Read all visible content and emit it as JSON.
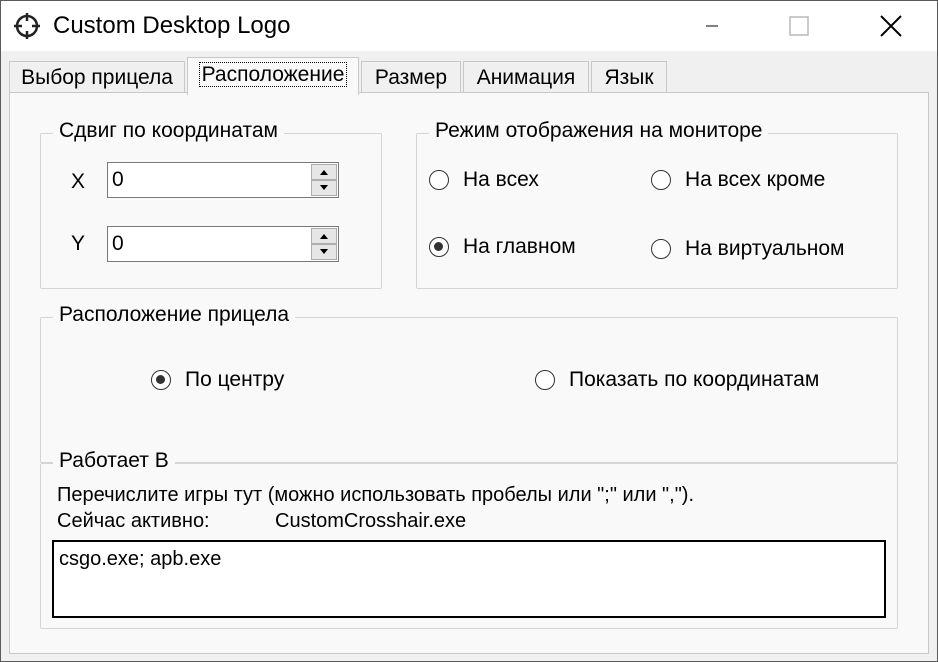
{
  "window": {
    "title": "Custom Desktop Logo"
  },
  "tabs": [
    {
      "label": "Выбор прицела",
      "active": false
    },
    {
      "label": "Расположение",
      "active": true
    },
    {
      "label": "Размер",
      "active": false
    },
    {
      "label": "Анимация",
      "active": false
    },
    {
      "label": "Язык",
      "active": false
    }
  ],
  "offset_group": {
    "title": "Сдвиг по координатам",
    "x_label": "X",
    "x_value": "0",
    "y_label": "Y",
    "y_value": "0"
  },
  "monitor_group": {
    "title": "Режим отображения на мониторе",
    "options": [
      {
        "label": "На всех",
        "checked": false
      },
      {
        "label": "На всех кроме",
        "checked": false
      },
      {
        "label": "На главном",
        "checked": true
      },
      {
        "label": "На виртуальном",
        "checked": false
      }
    ]
  },
  "position_group": {
    "title": "Расположение прицела",
    "options": [
      {
        "label": "По центру",
        "checked": true
      },
      {
        "label": "Показать по координатам",
        "checked": false
      }
    ]
  },
  "works_group": {
    "title": "Работает В",
    "hint": "Перечислите игры тут (можно использовать пробелы или \";\" или \",\").",
    "active_label": "Сейчас активно:",
    "active_value": "CustomCrosshair.exe",
    "games_value": "csgo.exe; apb.exe"
  },
  "icons": {
    "app": "crosshair-icon",
    "minimize": "minimize-icon",
    "maximize": "maximize-icon",
    "close": "close-icon"
  }
}
